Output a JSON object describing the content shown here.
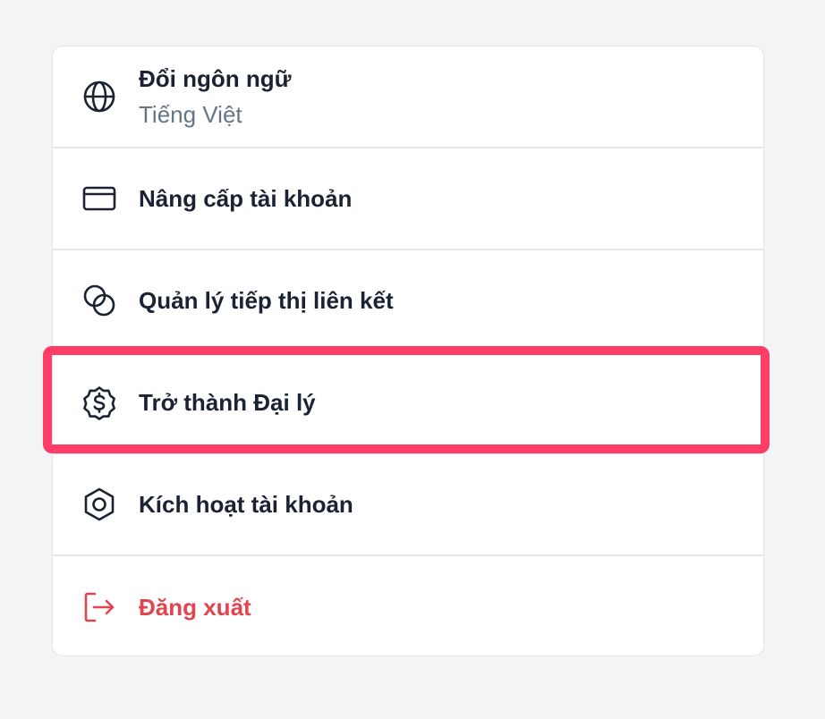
{
  "menu": {
    "items": [
      {
        "label": "Đổi ngôn ngữ",
        "sublabel": "Tiếng Việt",
        "icon": "globe-icon"
      },
      {
        "label": "Nâng cấp tài khoản",
        "icon": "credit-card-icon"
      },
      {
        "label": "Quản lý tiếp thị liên kết",
        "icon": "overlapping-circles-icon"
      },
      {
        "label": "Trở thành Đại lý",
        "icon": "dollar-badge-icon"
      },
      {
        "label": "Kích hoạt tài khoản",
        "icon": "hexagon-icon"
      },
      {
        "label": "Đăng xuất",
        "icon": "logout-icon"
      }
    ]
  },
  "colors": {
    "text": "#1a2233",
    "muted": "#647588",
    "danger": "#e0444f",
    "highlight": "#ff3d66",
    "divider": "#e3e7ec",
    "background": "#f3f4f6"
  }
}
